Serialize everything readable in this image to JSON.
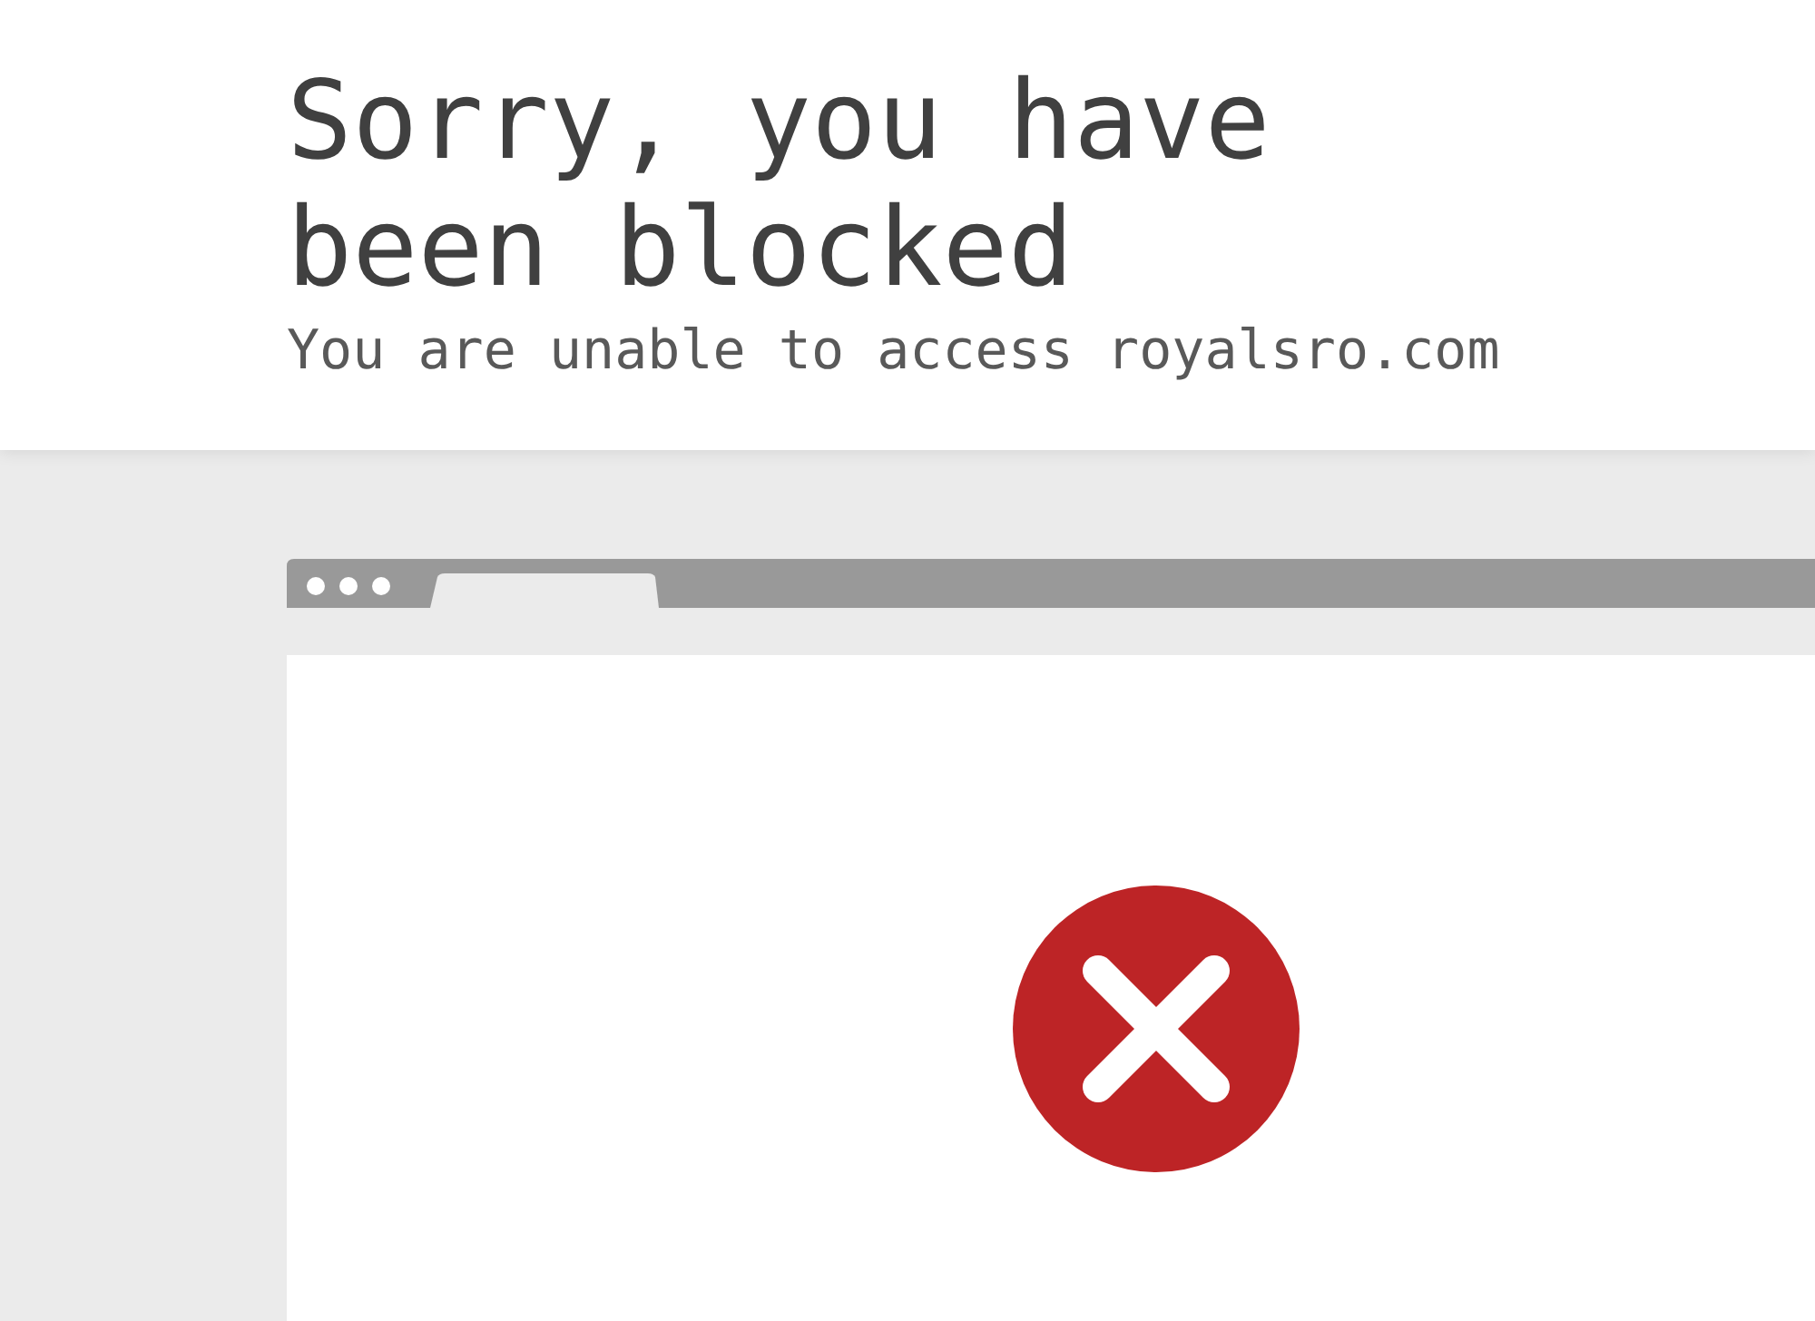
{
  "heading": "Sorry, you have been blocked",
  "subheading": "You are unable to access royalsro.com"
}
